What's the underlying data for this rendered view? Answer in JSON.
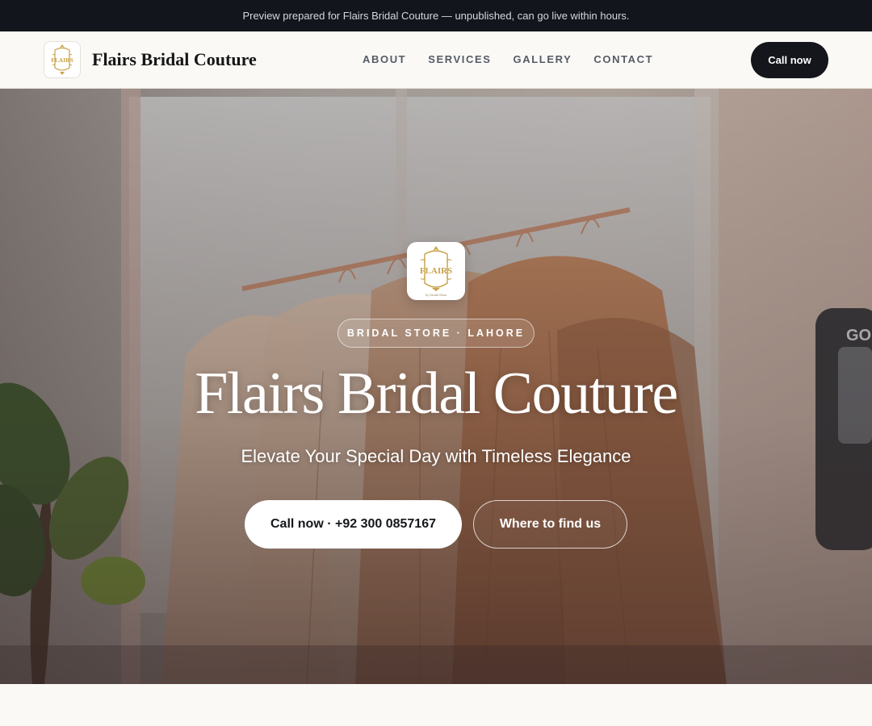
{
  "banner": {
    "text": "Preview prepared for Flairs Bridal Couture — unpublished, can go live within hours."
  },
  "header": {
    "brand_name": "Flairs Bridal Couture",
    "logo_icon": "flairs-crest-logo",
    "nav": [
      "ABOUT",
      "SERVICES",
      "GALLERY",
      "CONTACT"
    ],
    "call_label": "Call now"
  },
  "hero": {
    "logo_text": "FLAIRS",
    "logo_subtext": "by Zainab Khan",
    "badge": "BRIDAL STORE · LAHORE",
    "title": "Flairs Bridal Couture",
    "subtitle": "Elevate Your Special Day with Timeless Elegance",
    "primary_button": "Call now · +92 300 0857167",
    "secondary_button": "Where to find us",
    "background": "dresses-on-rack-photo"
  },
  "colors": {
    "topbar": "#12151b",
    "page_bg": "#faf9f6",
    "logo_gold": "#c9a24a",
    "button_dark": "#14161b"
  }
}
